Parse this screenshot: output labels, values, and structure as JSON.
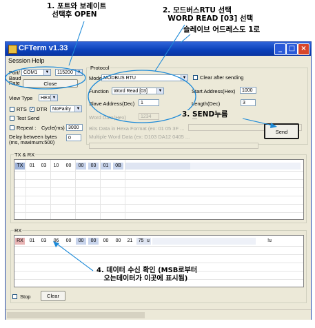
{
  "annotations": {
    "a1": "1. 포트와 보레이트\n  선택후 OPEN",
    "a2": "2. 모드버스RTU 선택\n  WORD READ [03] 선택",
    "a2b": "슬레이브 어드레스도 1로",
    "a3": "3. SEND누름",
    "a4": "4. 데이터 수신 확인 (MSB로부터\n   오는데이터가 이곳에 표시됨)"
  },
  "window": {
    "title": "CFTerm v1.33",
    "menu": [
      "Session",
      "Help"
    ],
    "buttons": {
      "minimize": "_",
      "maximize": "□",
      "close": "×"
    }
  },
  "left_panel": {
    "port_label": "Port/",
    "port_value": "COM1",
    "baud_label": "Baud\nRate",
    "baud_value": "115200",
    "close_button": "Close",
    "view_type_label": "View Type",
    "view_type_value": "HEX",
    "rts_label": "RTS",
    "dtr_label": "DTR",
    "parity_value": "NoParity",
    "test_send_label": "Test Send",
    "repeat_label": "Repeat :",
    "cycle_label": "Cycle(ms)",
    "cycle_value": "3000",
    "delay_label": "Delay between bytes\n(ms, maximum:500)",
    "delay_value": "0"
  },
  "protocol": {
    "group_label": "Protocol",
    "mode_label": "Mode",
    "mode_value": "MODBUS RTU",
    "clear_after_label": "Clear after sending",
    "function_label": "Function",
    "function_value": "Word Read [03]",
    "start_addr_label": "Start Address(Hex)",
    "start_addr_value": "1000",
    "slave_addr_label": "Slave Address(Dec)",
    "slave_addr_value": "1",
    "length_label": "Length(Dec)",
    "length_value": "3",
    "word_data_label": "Word Data(Hex)",
    "word_data_value": "1234",
    "bit_on_label": "Bit On",
    "bits_label": "Bits Data in Hexa Format (ex: 01 05 3F ...",
    "multi_word_label": "Multiple Word Data (ex: D103 DA12 0405 ...",
    "send_button": "Send"
  },
  "txrx": {
    "group_label": "TX & RX",
    "row_label": "TX",
    "cells": [
      "01",
      "03",
      "10",
      "00",
      "00",
      "03",
      "01",
      "0B"
    ]
  },
  "rx": {
    "group_label": "RX",
    "row_label": "RX",
    "cells": [
      "01",
      "03",
      "06",
      "00",
      "00",
      "00",
      "00",
      "00",
      "21",
      "75"
    ],
    "tail": "u",
    "right_text": "!u"
  },
  "bottom": {
    "stop_label": "Stop",
    "clear_button": "Clear"
  }
}
